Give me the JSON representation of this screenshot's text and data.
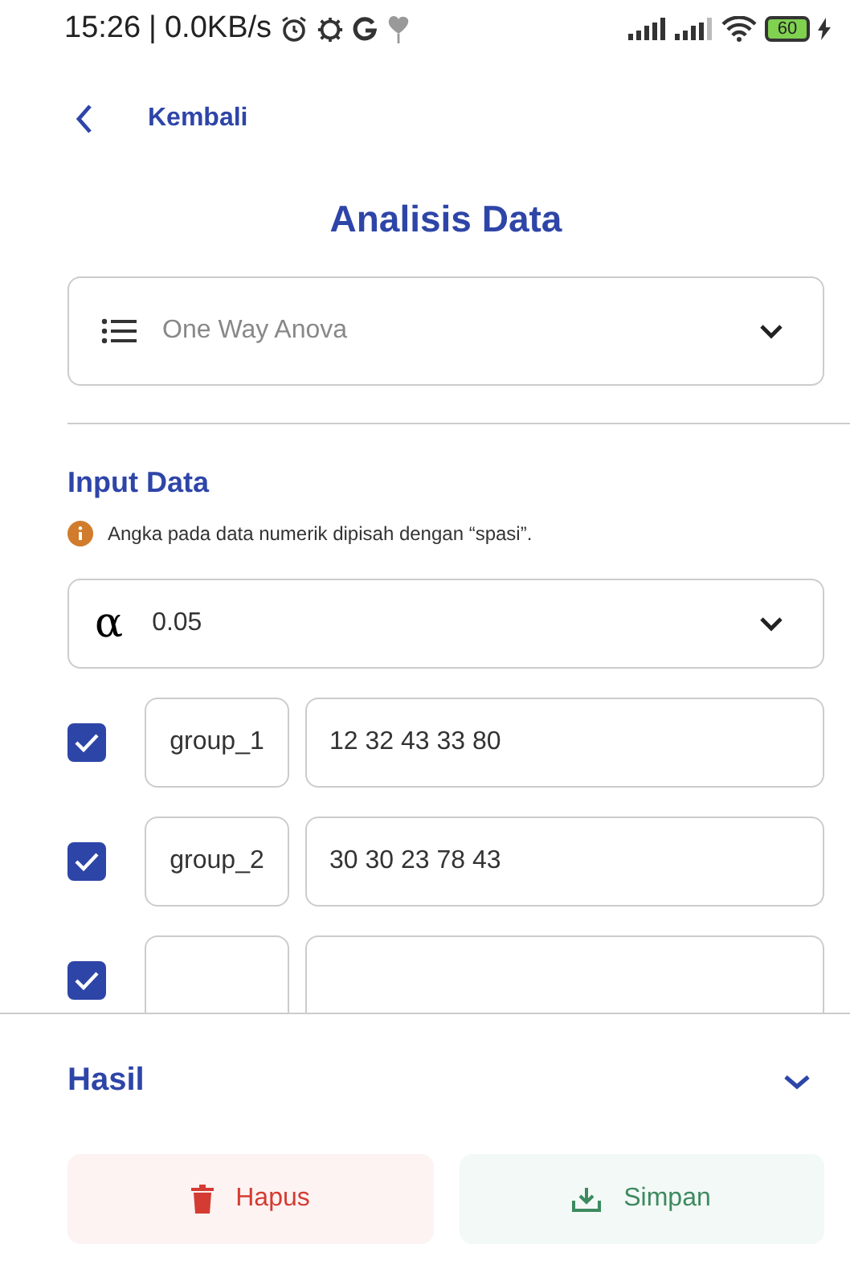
{
  "status_bar": {
    "time": "15:26",
    "separator": "|",
    "speed": "0.0KB/s",
    "battery": "60"
  },
  "back": {
    "label": "Kembali"
  },
  "title": "Analisis Data",
  "method": {
    "value": "One Way Anova"
  },
  "input_section": {
    "heading": "Input Data",
    "note": "Angka pada data numerik dipisah dengan “spasi”."
  },
  "alpha": {
    "symbol": "α",
    "value": "0.05"
  },
  "groups": [
    {
      "checked": true,
      "name": "group_1",
      "values": "12 32 43 33 80"
    },
    {
      "checked": true,
      "name": "group_2",
      "values": "30 30 23 78 43"
    },
    {
      "checked": true
    }
  ],
  "result": {
    "heading": "Hasil",
    "expanded": false
  },
  "buttons": [
    {
      "kind": "delete",
      "label": "Hapus"
    },
    {
      "kind": "save",
      "label": "Simpan"
    }
  ]
}
